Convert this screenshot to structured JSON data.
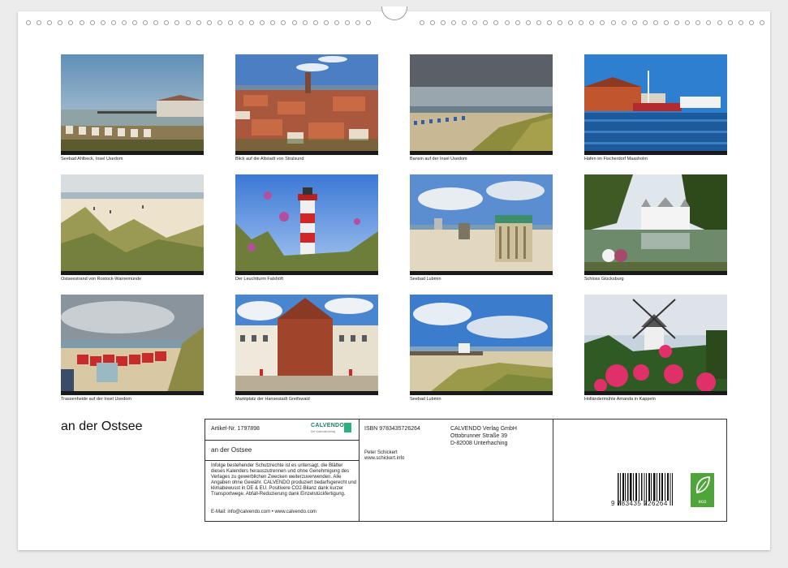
{
  "photos": [
    {
      "caption": "Seebad Ahlbeck, Insel Usedom"
    },
    {
      "caption": "Blick auf die Altstadt von Stralsund"
    },
    {
      "caption": "Bansin auf der Insel Usedom"
    },
    {
      "caption": "Hafen im Fischerdorf Maasholm"
    },
    {
      "caption": "Ostseestrand von Rostock-Warnemünde"
    },
    {
      "caption": "Der Leuchtturm Falshöft"
    },
    {
      "caption": "Seebad Lubmin"
    },
    {
      "caption": "Schloss Glücksburg"
    },
    {
      "caption": "Trassenheide auf der Insel Usedom"
    },
    {
      "caption": "Marktplatz der Hansestadt Greifswald"
    },
    {
      "caption": "Seebad Lubmin"
    },
    {
      "caption": "Holländermühle Amanda in Kappeln"
    }
  ],
  "title": "an der Ostsee",
  "info": {
    "article": "Artikel-Nr. 1797898",
    "logo": "CALVENDO",
    "logo_sub": "Der Kalenderverlag",
    "calendar_title": "an der Ostsee",
    "legal_text": "Infolge bestehender Schutzrechte ist es untersagt, die Blätter dieses Kalenders herauszutrennen und ohne Genehmigung des Verlages zu gewerblichen Zwecken weiterzuverwenden. Alle Angaben ohne Gewähr. CALVENDO produziert bedarfsgerecht und klimabewusst in DE & EU. Positivere CO2-Bilanz dank kurzer Transportwege. Abfall-Reduzierung dank Einzelstückfertigung.",
    "email": "E-Mail: info@calvendo.com • www.calvendo.com",
    "isbn": "ISBN 9783435726264",
    "author": "Peter Schickert",
    "author_web": "www.schickert.info",
    "publisher": "CALVENDO Verlag GmbH",
    "street": "Ottobrunner Straße 39",
    "city": "D-82008 Unterhaching",
    "barcode_number": "9 783435 726264",
    "eco_label": "eco"
  },
  "colors": {
    "eco_green": "#4fa53a",
    "calvendo_green": "#1a7d63"
  }
}
